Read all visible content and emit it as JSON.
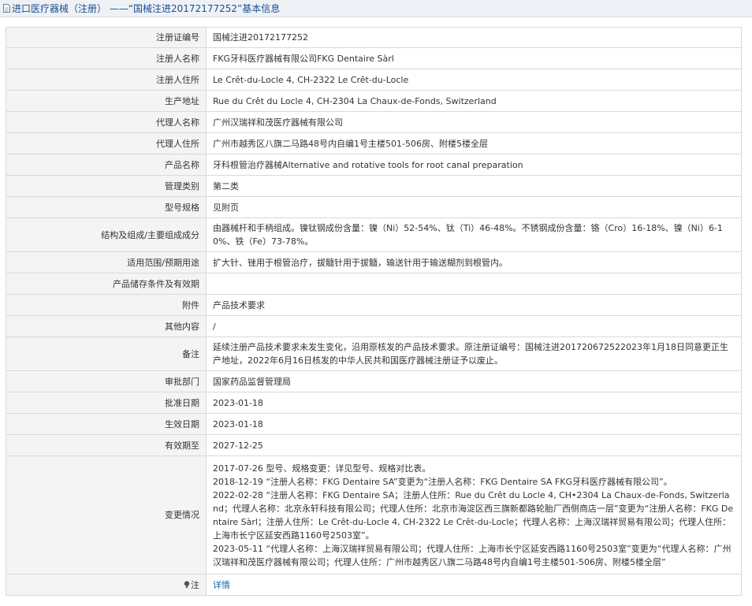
{
  "header": {
    "title": "进口医疗器械（注册） ——“国械注进20172177252”基本信息",
    "icon": "document-icon"
  },
  "rows": [
    {
      "label": "注册证编号",
      "value": "国械注进20172177252"
    },
    {
      "label": "注册人名称",
      "value": "FKG牙科医疗器械有限公司FKG Dentaire Sàrl"
    },
    {
      "label": "注册人住所",
      "value": "Le Crêt-du-Locle 4, CH-2322 Le Crêt-du-Locle"
    },
    {
      "label": "生产地址",
      "value": "Rue du Crêt du Locle 4, CH-2304 La Chaux-de-Fonds, Switzerland"
    },
    {
      "label": "代理人名称",
      "value": "广州汉瑞祥和茂医疗器械有限公司"
    },
    {
      "label": "代理人住所",
      "value": "广州市越秀区八旗二马路48号内自编1号主楼501-506房、附楼5楼全层"
    },
    {
      "label": "产品名称",
      "value": "牙科根管治疗器械Alternative and rotative tools for root canal preparation"
    },
    {
      "label": "管理类别",
      "value": "第二类"
    },
    {
      "label": "型号规格",
      "value": "见附页"
    },
    {
      "label": "结构及组成/主要组成成分",
      "value": "由器械杆和手柄组成。镍钛钢成份含量：镍（Ni）52-54%、钛（Ti）46-48%。不锈钢成份含量：铬（Cro）16-18%、镍（Ni）6-10%、铁（Fe）73-78%。"
    },
    {
      "label": "适用范围/预期用途",
      "value": "扩大针、锉用于根管治疗，拔髓针用于拔髓，输送针用于输送糊剂到根管内。"
    },
    {
      "label": "产品储存条件及有效期",
      "value": ""
    },
    {
      "label": "附件",
      "value": "产品技术要求"
    },
    {
      "label": "其他内容",
      "value": "/"
    },
    {
      "label": "备注",
      "value": "延续注册产品技术要求未发生变化，沿用原核发的产品技术要求。原注册证编号：国械注进201720672522023年1月18日同意更正生产地址，2022年6月16日核发的中华人民共和国医疗器械注册证予以废止。"
    },
    {
      "label": "审批部门",
      "value": "国家药品监督管理局"
    },
    {
      "label": "批准日期",
      "value": "2023-01-18"
    },
    {
      "label": "生效日期",
      "value": "2023-01-18"
    },
    {
      "label": "有效期至",
      "value": "2027-12-25"
    }
  ],
  "changes": {
    "label": "变更情况",
    "lines": [
      "2017-07-26 型号、规格变更：详见型号、规格对比表。",
      "2018-12-19 “注册人名称：FKG Dentaire SA”变更为“注册人名称：FKG Dentaire SA FKG牙科医疗器械有限公司”。",
      "2022-02-28 “注册人名称：FKG Dentaire SA；注册人住所：Rue du Crêt du Locle 4, CH•2304 La Chaux-de-Fonds, Switzerland；代理人名称：北京永轩科技有限公司；代理人住所：北京市海淀区西三旗新都路轮胎厂西侧商店一层”变更为“注册人名称：FKG Dentaire Sàrl；注册人住所：Le Crêt-du-Locle 4, CH-2322 Le Crêt-du-Locle；代理人名称：上海汉瑞祥贸易有限公司；代理人住所：上海市长宁区延安西路1160号2503室”。",
      "2023-05-11 “代理人名称：上海汉瑞祥贸易有限公司；代理人住所：上海市长宁区延安西路1160号2503室”变更为“代理人名称：广州汉瑞祥和茂医疗器械有限公司；代理人住所：广州市越秀区八旗二马路48号内自编1号主楼501-506房、附楼5楼全层”"
    ]
  },
  "note_row": {
    "label": "注",
    "icon": "lightbulb-icon",
    "link": "详情"
  }
}
